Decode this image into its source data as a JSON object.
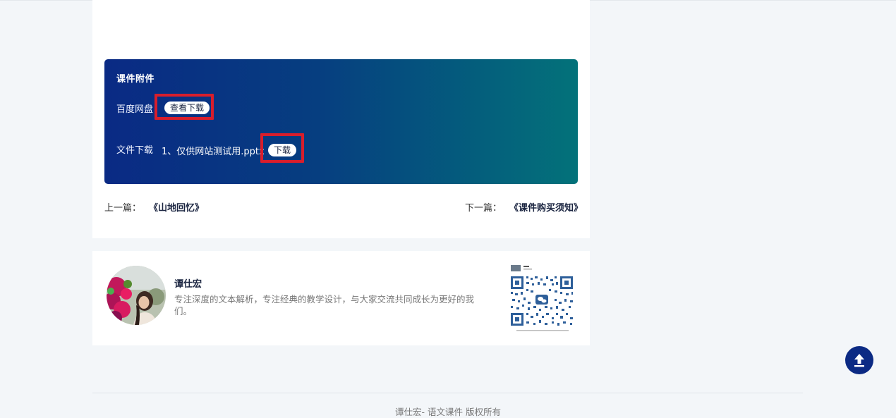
{
  "attachment": {
    "title": "课件附件",
    "baidu_label": "百度网盘",
    "baidu_button": "查看下载",
    "file_label": "文件下载",
    "file_name": "1、仅供网站测试用.pptx",
    "download_button": "下载",
    "highlight_color": "#d81e2c",
    "gradient": [
      "#0a2a84",
      "#03727a"
    ]
  },
  "post_nav": {
    "prev_label": "上一篇：",
    "prev_title": "《山地回忆》",
    "next_label": "下一篇：",
    "next_title": "《课件购买须知》"
  },
  "author": {
    "name": "谭仕宏",
    "bio": "专注深度的文本解析，专注经典的教学设计，与大家交流共同成长为更好的我们。",
    "avatar_icon": "person-photo",
    "qr_icon": "wechat-qr-code"
  },
  "back_to_top_icon": "arrow-up-icon",
  "footer": {
    "text": "谭仕宏- 语文课件 版权所有"
  }
}
